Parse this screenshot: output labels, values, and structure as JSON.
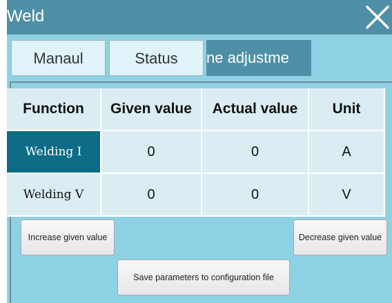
{
  "window": {
    "title": "Weld"
  },
  "tabs": [
    {
      "label": "Manaul"
    },
    {
      "label": "Status"
    },
    {
      "label": "ne adjustme"
    }
  ],
  "table": {
    "headers": [
      "Function",
      "Given value",
      "Actual value",
      "Unit"
    ],
    "rows": [
      {
        "function": "Welding I",
        "given": "0",
        "actual": "0",
        "unit": "A"
      },
      {
        "function": "Welding V",
        "given": "0",
        "actual": "0",
        "unit": "V"
      }
    ]
  },
  "buttons": {
    "increase": "Increase given value",
    "decrease": "Decrease given value",
    "save": "Save parameters to configuration file"
  },
  "colors": {
    "window_bg": "#8fd1e4",
    "titlebar": "#4f8fa6",
    "selected_cell": "#0d6c86",
    "cell_bg": "#dbedf2"
  }
}
